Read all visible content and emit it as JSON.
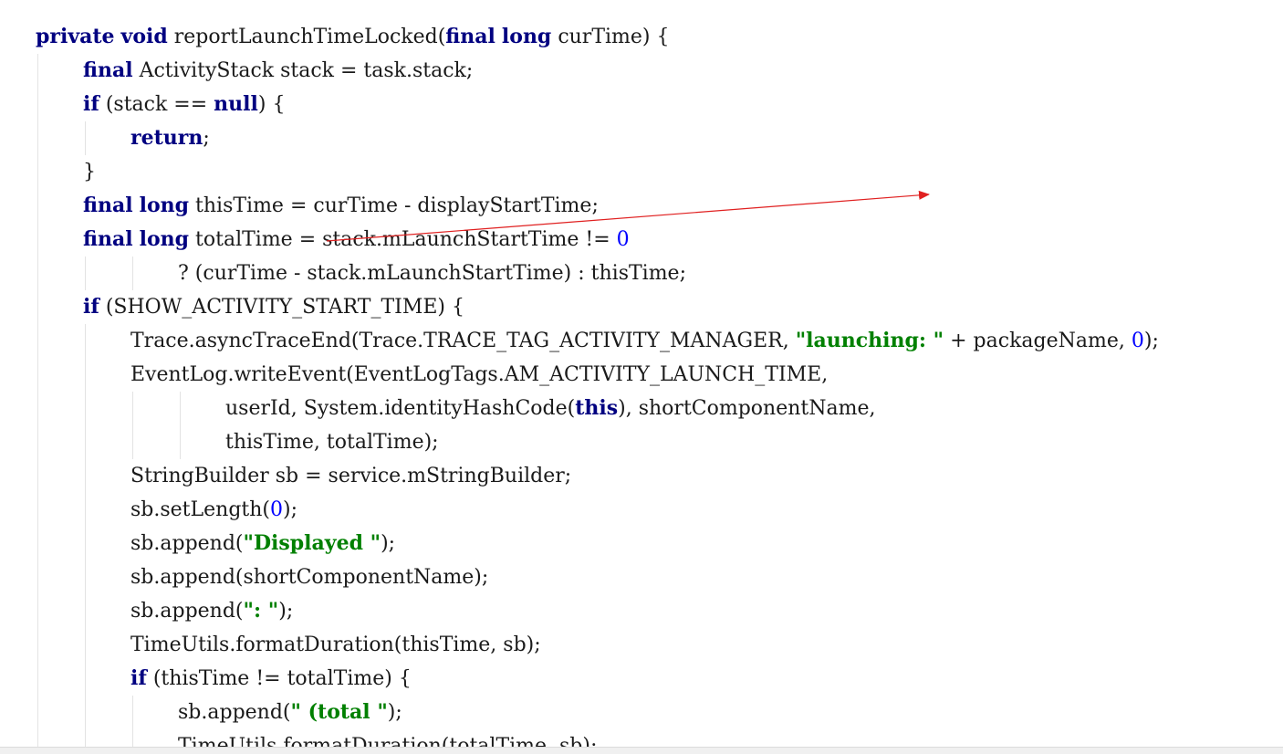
{
  "code_lines": [
    {
      "indent": 0,
      "tokens": [
        {
          "t": "private",
          "k": "keyword"
        },
        {
          "t": " "
        },
        {
          "t": "void",
          "k": "keyword"
        },
        {
          "t": " reportLaunchTimeLocked("
        },
        {
          "t": "final",
          "k": "keyword"
        },
        {
          "t": " "
        },
        {
          "t": "long",
          "k": "keyword"
        },
        {
          "t": " curTime) {"
        }
      ]
    },
    {
      "indent": 1,
      "tokens": [
        {
          "t": "final",
          "k": "keyword"
        },
        {
          "t": " ActivityStack stack = task.stack;"
        }
      ]
    },
    {
      "indent": 1,
      "tokens": [
        {
          "t": "if",
          "k": "keyword"
        },
        {
          "t": " (stack == "
        },
        {
          "t": "null",
          "k": "keyword"
        },
        {
          "t": ") {"
        }
      ]
    },
    {
      "indent": 2,
      "tokens": [
        {
          "t": "return",
          "k": "keyword"
        },
        {
          "t": ";"
        }
      ]
    },
    {
      "indent": 1,
      "tokens": [
        {
          "t": "}"
        }
      ]
    },
    {
      "indent": 1,
      "tokens": [
        {
          "t": "final",
          "k": "keyword"
        },
        {
          "t": " "
        },
        {
          "t": "long",
          "k": "keyword"
        },
        {
          "t": " thisTime = curTime - displayStartTime;"
        }
      ]
    },
    {
      "indent": 1,
      "tokens": [
        {
          "t": "final",
          "k": "keyword"
        },
        {
          "t": " "
        },
        {
          "t": "long",
          "k": "keyword"
        },
        {
          "t": " totalTime = stack.mLaunchStartTime != "
        },
        {
          "t": "0",
          "k": "number"
        }
      ]
    },
    {
      "indent": 3,
      "tokens": [
        {
          "t": "? (curTime - stack.mLaunchStartTime) : thisTime;"
        }
      ]
    },
    {
      "indent": 1,
      "tokens": [
        {
          "t": "if",
          "k": "keyword"
        },
        {
          "t": " (SHOW_ACTIVITY_START_TIME) {"
        }
      ]
    },
    {
      "indent": 2,
      "tokens": [
        {
          "t": "Trace.asyncTraceEnd(Trace.TRACE_TAG_ACTIVITY_MANAGER, "
        },
        {
          "t": "\"launching: \"",
          "k": "string"
        },
        {
          "t": " + packageName, "
        },
        {
          "t": "0",
          "k": "number"
        },
        {
          "t": ");"
        }
      ]
    },
    {
      "indent": 2,
      "tokens": [
        {
          "t": "EventLog.writeEvent(EventLogTags.AM_ACTIVITY_LAUNCH_TIME,"
        }
      ]
    },
    {
      "indent": 4,
      "tokens": [
        {
          "t": "userId, System.identityHashCode("
        },
        {
          "t": "this",
          "k": "keyword"
        },
        {
          "t": "), shortComponentName,"
        }
      ]
    },
    {
      "indent": 4,
      "tokens": [
        {
          "t": "thisTime, totalTime);"
        }
      ]
    },
    {
      "indent": 2,
      "tokens": [
        {
          "t": "StringBuilder sb = service.mStringBuilder;"
        }
      ]
    },
    {
      "indent": 2,
      "tokens": [
        {
          "t": "sb.setLength("
        },
        {
          "t": "0",
          "k": "number"
        },
        {
          "t": ");"
        }
      ]
    },
    {
      "indent": 2,
      "tokens": [
        {
          "t": "sb.append("
        },
        {
          "t": "\"Displayed \"",
          "k": "string"
        },
        {
          "t": ");"
        }
      ]
    },
    {
      "indent": 2,
      "tokens": [
        {
          "t": "sb.append(shortComponentName);"
        }
      ]
    },
    {
      "indent": 2,
      "tokens": [
        {
          "t": "sb.append("
        },
        {
          "t": "\": \"",
          "k": "string"
        },
        {
          "t": ");"
        }
      ]
    },
    {
      "indent": 2,
      "tokens": [
        {
          "t": "TimeUtils.formatDuration(thisTime, sb);"
        }
      ]
    },
    {
      "indent": 2,
      "tokens": [
        {
          "t": "if",
          "k": "keyword"
        },
        {
          "t": " (thisTime != totalTime) {"
        }
      ]
    },
    {
      "indent": 3,
      "tokens": [
        {
          "t": "sb.append("
        },
        {
          "t": "\" (total \"",
          "k": "string"
        },
        {
          "t": ");"
        }
      ]
    },
    {
      "indent": 3,
      "tokens": [
        {
          "t": "TimeUtils.formatDuration(totalTime, sb);"
        }
      ]
    }
  ],
  "colors": {
    "keyword": "#000080",
    "string": "#008000",
    "number": "#0000ff",
    "text": "#1a1a1a",
    "indent_guide": "#e3e3e3",
    "annotation_arrow": "#e02020"
  }
}
